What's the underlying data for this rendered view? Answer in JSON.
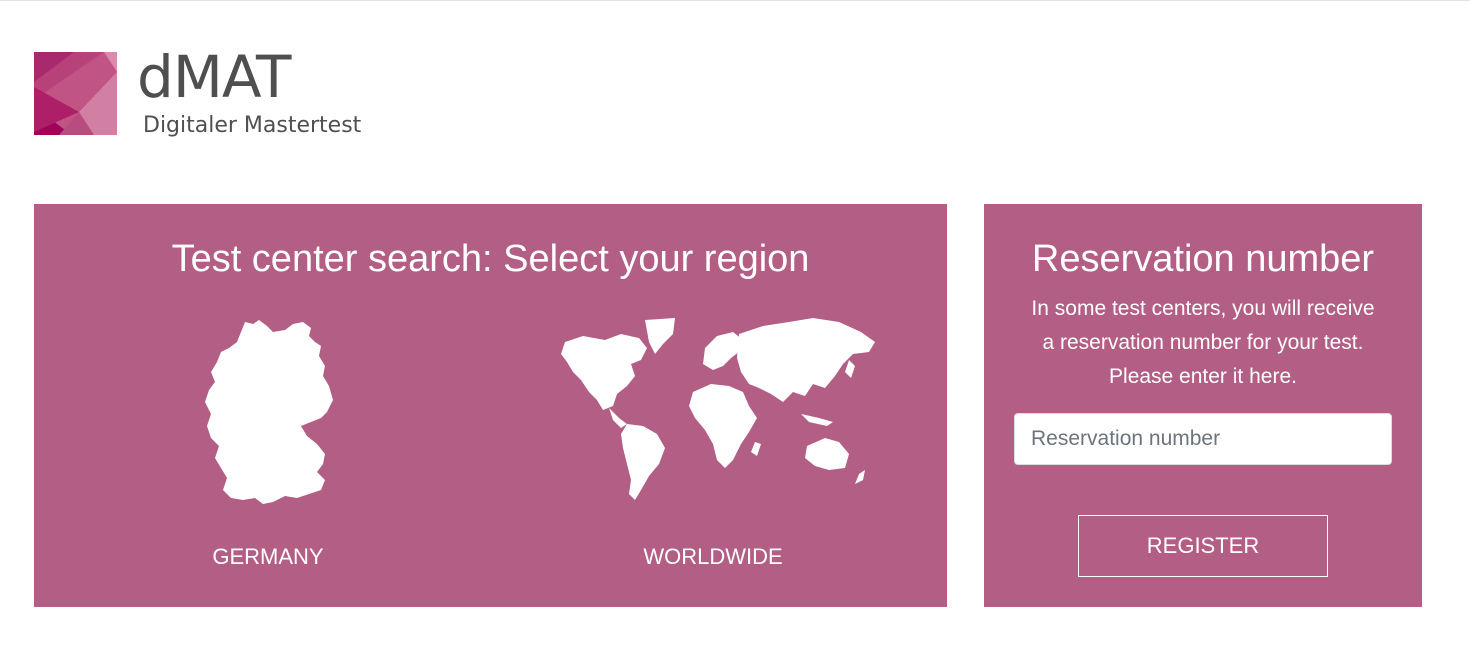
{
  "brand": {
    "title": "dMAT",
    "subtitle": "Digitaler Mastertest",
    "logo_icon": "dmat-logo-icon",
    "colors": {
      "panel": "#b35e85",
      "logo_dark": "#a3005a",
      "text_gray": "#4f4f4f"
    }
  },
  "region_search": {
    "title": "Test center search: Select your region",
    "regions": [
      {
        "id": "germany",
        "label": "GERMANY",
        "icon": "germany-map-icon"
      },
      {
        "id": "worldwide",
        "label": "WORLDWIDE",
        "icon": "world-map-icon"
      }
    ]
  },
  "reservation": {
    "title": "Reservation number",
    "description_lines": [
      "In some test centers, you will receive",
      "a reservation number for your test.",
      "Please enter it here."
    ],
    "input_placeholder": "Reservation number",
    "input_value": "",
    "register_label": "REGISTER"
  }
}
